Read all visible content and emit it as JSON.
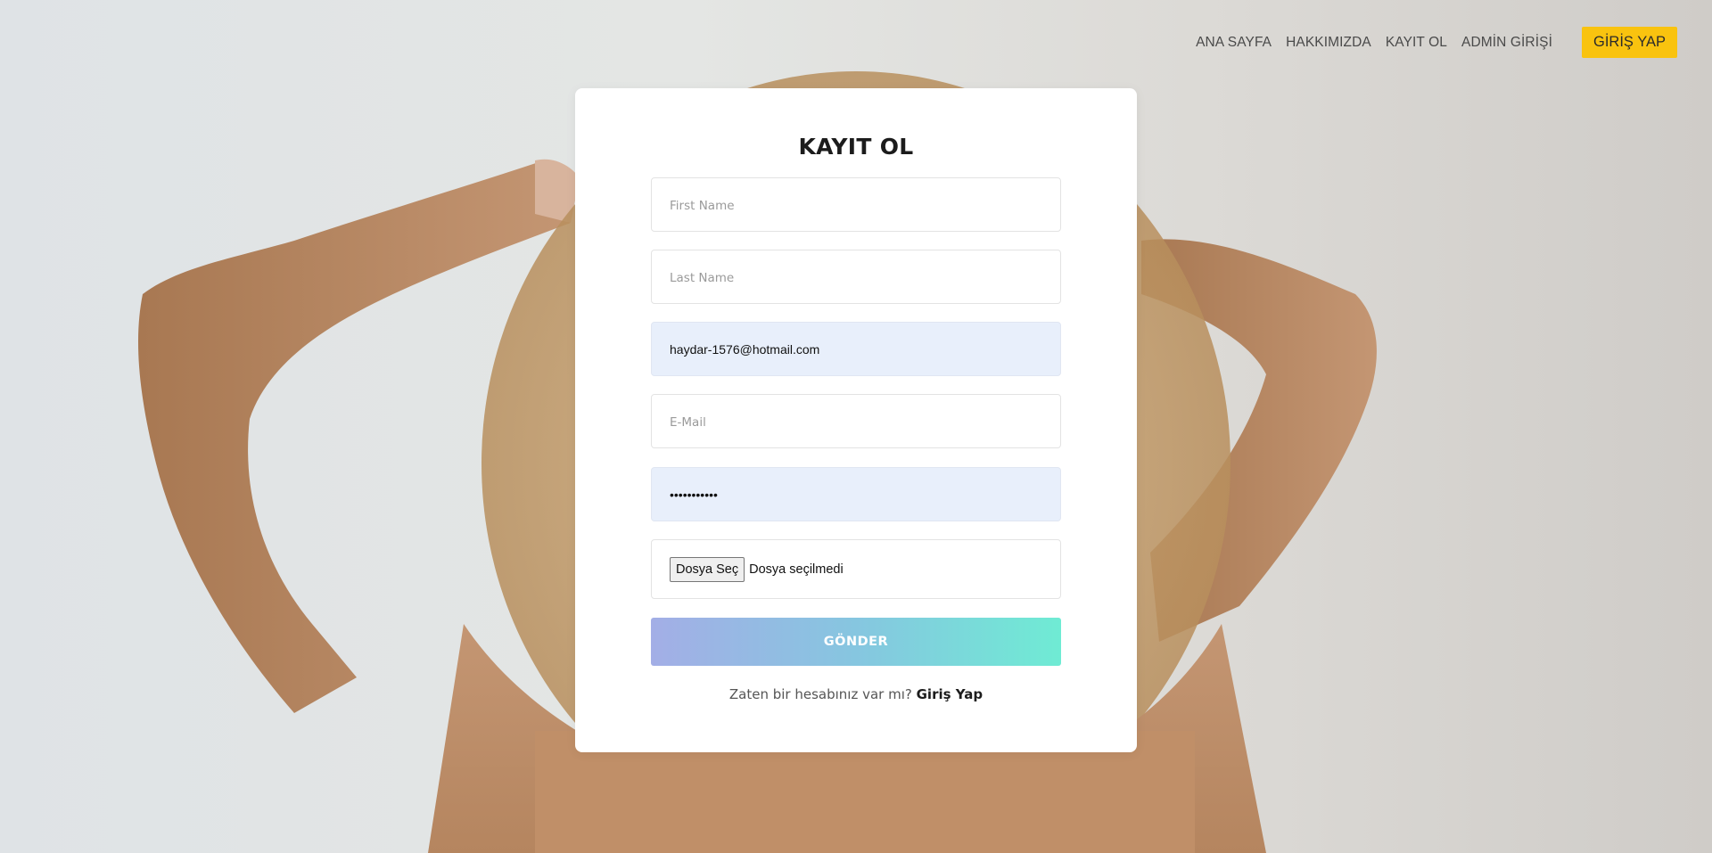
{
  "navbar": {
    "links": [
      "ANA SAYFA",
      "HAKKIMIZDA",
      "KAYIT OL",
      "ADMİN GİRİŞİ"
    ],
    "login_button": "GİRİŞ YAP",
    "login_button_color": "#f9c30f"
  },
  "form": {
    "title": "KAYIT OL",
    "first_name": {
      "placeholder": "First Name",
      "value": ""
    },
    "last_name": {
      "placeholder": "Last Name",
      "value": ""
    },
    "username_email": {
      "placeholder": "",
      "value": "haydar-1576@hotmail.com"
    },
    "email": {
      "placeholder": "E-Mail",
      "value": ""
    },
    "password": {
      "placeholder": "",
      "value": "•••••••••••"
    },
    "file": {
      "button_label": "Dosya Seç",
      "status": "Dosya seçilmedi"
    },
    "submit_label": "GÖNDER",
    "footer_text": "Zaten bir hesabınız var mı?",
    "footer_link": "Giriş Yap"
  },
  "colors": {
    "autofill_background": "#e8effb",
    "submit_gradient_start": "#a3aee6",
    "submit_gradient_end": "#6febd4"
  },
  "background": {
    "subject": "woman in tan sweatshirt with curly hair, hands behind head"
  }
}
